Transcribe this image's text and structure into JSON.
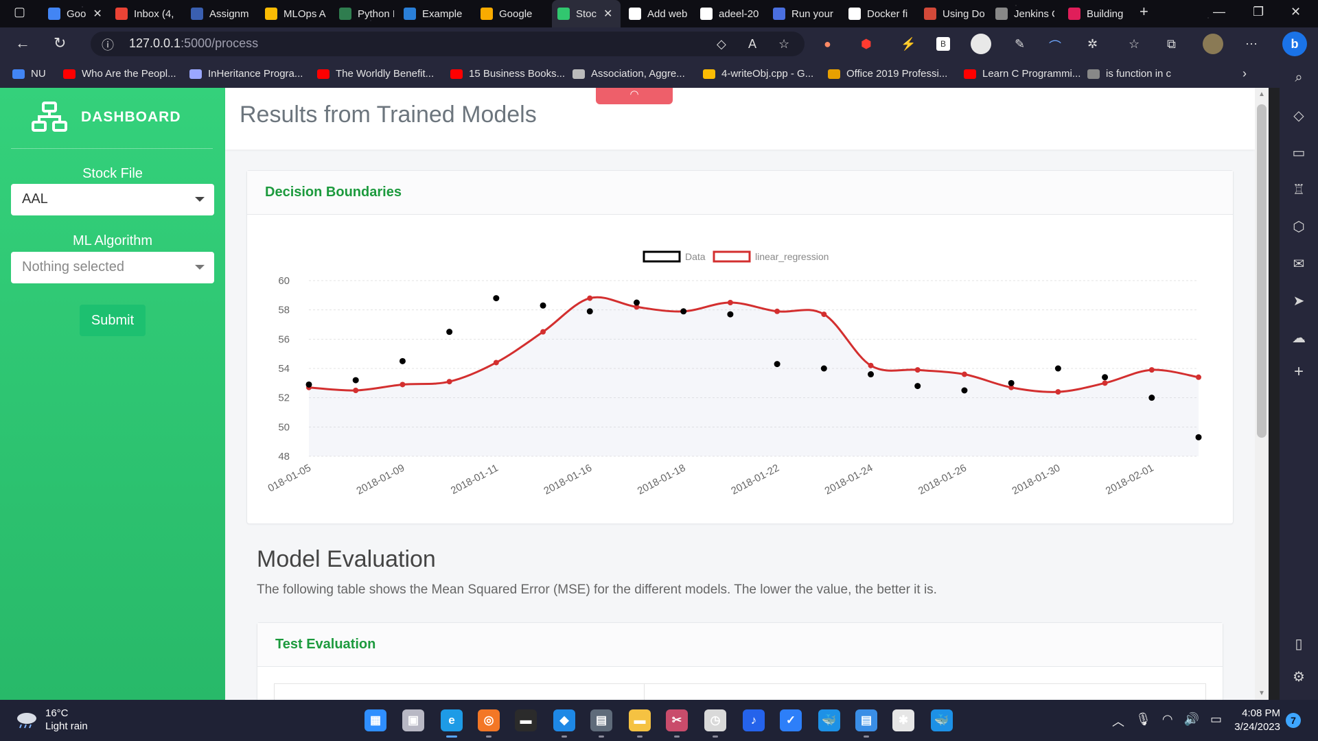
{
  "browser": {
    "tabs": [
      {
        "label": "Goo",
        "favicon": "google-icon",
        "color": "#4285f4"
      },
      {
        "label": "Inbox (4,",
        "favicon": "gmail-icon",
        "color": "#ea4335"
      },
      {
        "label": "Assignm",
        "favicon": "classroom-icon",
        "color": "#3a5fb0"
      },
      {
        "label": "MLOps A",
        "favicon": "drive-icon",
        "color": "#fbbc04"
      },
      {
        "label": "Python M",
        "favicon": "python-icon",
        "color": "#2f7d4f"
      },
      {
        "label": "Example",
        "favicon": "docs-icon",
        "color": "#2a7fd8"
      },
      {
        "label": "Google",
        "favicon": "keep-icon",
        "color": "#f9ab00"
      },
      {
        "label": "Stoc",
        "favicon": "dashboard-icon",
        "color": "#31c76f"
      },
      {
        "label": "Add web",
        "favicon": "github-icon",
        "color": "#ffffff"
      },
      {
        "label": "adeel-20",
        "favicon": "github-icon",
        "color": "#ffffff"
      },
      {
        "label": "Run your",
        "favicon": "orb-icon",
        "color": "#4a6fe0"
      },
      {
        "label": "Docker fi",
        "favicon": "github-icon",
        "color": "#ffffff"
      },
      {
        "label": "Using Do",
        "favicon": "jenkins-icon",
        "color": "#d24939"
      },
      {
        "label": "Jenkins C",
        "favicon": "jenkins-icon",
        "color": "#888888"
      },
      {
        "label": "Building",
        "favicon": "slack-icon",
        "color": "#e01e5a"
      }
    ],
    "address": {
      "host": "127.0.0.1",
      "path": ":5000/process"
    },
    "bookmarks": [
      {
        "label": "NU",
        "color": "#4285f4"
      },
      {
        "label": "Who Are the Peopl...",
        "color": "#ff0000"
      },
      {
        "label": "InHeritance Progra...",
        "color": "#9aa7ff"
      },
      {
        "label": "The Worldly Benefit...",
        "color": "#ff0000"
      },
      {
        "label": "15 Business Books...",
        "color": "#ff0000"
      },
      {
        "label": "Association, Aggre...",
        "color": "#bbbbbb"
      },
      {
        "label": "4-writeObj.cpp - G...",
        "color": "#fbbc04"
      },
      {
        "label": "Office 2019 Professi...",
        "color": "#e8a000"
      },
      {
        "label": "Learn C Programmi...",
        "color": "#ff0000"
      },
      {
        "label": "is function in c",
        "color": "#888888"
      }
    ]
  },
  "app": {
    "brand": "DASHBOARD",
    "page_title": "Results from Trained Models",
    "stock_file_label": "Stock File",
    "stock_file_value": "AAL",
    "algorithm_label": "ML Algorithm",
    "algorithm_placeholder": "Nothing selected",
    "submit_label": "Submit",
    "chart_card_title": "Decision Boundaries",
    "eval_title": "Model Evaluation",
    "eval_desc": "The following table shows the Mean Squared Error (MSE) for the different models. The lower the value, the better it is.",
    "eval_card_title": "Test Evaluation"
  },
  "chart_data": {
    "type": "line",
    "xlabel": "",
    "ylabel": "",
    "ylim": [
      48,
      60
    ],
    "yticks": [
      48,
      50,
      52,
      54,
      56,
      58,
      60
    ],
    "grid": true,
    "legend_position": "top-center",
    "x_tick_labels": [
      "018-01-05",
      "2018-01-09",
      "2018-01-11",
      "2018-01-16",
      "2018-01-18",
      "2018-01-22",
      "2018-01-24",
      "2018-01-26",
      "2018-01-30",
      "2018-02-01"
    ],
    "x": [
      "2018-01-05",
      "2018-01-08",
      "2018-01-09",
      "2018-01-10",
      "2018-01-11",
      "2018-01-12",
      "2018-01-16",
      "2018-01-17",
      "2018-01-18",
      "2018-01-19",
      "2018-01-22",
      "2018-01-23",
      "2018-01-24",
      "2018-01-25",
      "2018-01-26",
      "2018-01-29",
      "2018-01-30",
      "2018-01-31",
      "2018-02-01",
      "2018-02-02"
    ],
    "series": [
      {
        "name": "Data",
        "style": "scatter",
        "color": "#000000",
        "values": [
          52.9,
          53.2,
          54.5,
          56.5,
          58.8,
          58.3,
          57.9,
          58.5,
          57.9,
          57.7,
          54.3,
          54.0,
          53.6,
          52.8,
          52.5,
          53.0,
          54.0,
          53.4,
          52.0,
          49.3
        ]
      },
      {
        "name": "linear_regression",
        "style": "line",
        "color": "#d32f2f",
        "values": [
          52.7,
          52.5,
          52.9,
          53.1,
          54.4,
          56.5,
          58.8,
          58.2,
          57.9,
          58.5,
          57.9,
          57.7,
          54.2,
          53.9,
          53.6,
          52.7,
          52.4,
          53.0,
          53.9,
          53.4
        ]
      }
    ]
  },
  "taskbar": {
    "weather_temp": "16°C",
    "weather_desc": "Light rain",
    "time": "4:08 PM",
    "date": "3/24/2023",
    "notifications": "7",
    "apps": [
      {
        "name": "start-icon",
        "color": "#2f8fff"
      },
      {
        "name": "task-view-icon",
        "color": "#b8b8c4"
      },
      {
        "name": "edge-icon",
        "color": "#1e9be6"
      },
      {
        "name": "jupyter-icon",
        "color": "#f37726"
      },
      {
        "name": "terminal-icon",
        "color": "#2b2b2b"
      },
      {
        "name": "vscode-icon",
        "color": "#1e88e5"
      },
      {
        "name": "calculator-icon",
        "color": "#5f6b7a"
      },
      {
        "name": "file-explorer-icon",
        "color": "#f5c242"
      },
      {
        "name": "snipping-tool-icon",
        "color": "#c94c6b"
      },
      {
        "name": "clock-icon",
        "color": "#d9d9d9"
      },
      {
        "name": "voice-recorder-icon",
        "color": "#2563eb"
      },
      {
        "name": "todo-icon",
        "color": "#2d7ff9"
      },
      {
        "name": "docker-icon",
        "color": "#1d91e6"
      },
      {
        "name": "notepad-icon",
        "color": "#3a8ee6"
      },
      {
        "name": "slack-icon",
        "color": "#e6e6e6"
      },
      {
        "name": "docker-desktop-icon",
        "color": "#1d91e6"
      }
    ]
  }
}
